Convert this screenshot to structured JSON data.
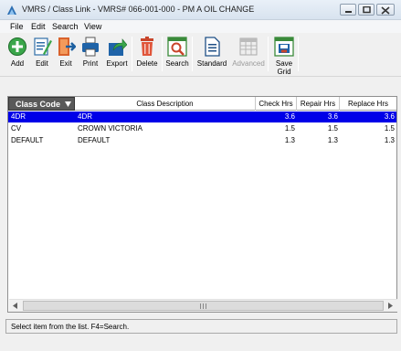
{
  "window": {
    "title": "VMRS / Class Link - VMRS# 066-001-000 - PM A OIL CHANGE"
  },
  "menu": [
    "File",
    "Edit",
    "Search",
    "View"
  ],
  "toolbar": {
    "add": "Add",
    "edit": "Edit",
    "exit": "Exit",
    "print": "Print",
    "export": "Export",
    "delete": "Delete",
    "search": "Search",
    "standard": "Standard",
    "advanced": "Advanced",
    "save_grid_1": "Save",
    "save_grid_2": "Grid"
  },
  "grid": {
    "columns": {
      "class_code": "Class Code",
      "class_description": "Class Description",
      "check_hrs": "Check Hrs",
      "repair_hrs": "Repair Hrs",
      "replace_hrs": "Replace Hrs"
    },
    "rows": [
      {
        "code": "4DR",
        "desc": "4DR",
        "check": "3.6",
        "repair": "3.6",
        "replace": "3.6",
        "selected": true
      },
      {
        "code": "CV",
        "desc": "CROWN VICTORIA",
        "check": "1.5",
        "repair": "1.5",
        "replace": "1.5",
        "selected": false
      },
      {
        "code": "DEFAULT",
        "desc": "DEFAULT",
        "check": "1.3",
        "repair": "1.3",
        "replace": "1.3",
        "selected": false
      }
    ]
  },
  "status": {
    "text": "Select item from the list. F4=Search."
  },
  "colors": {
    "selection": "#0000e8",
    "header_first": "#595959"
  },
  "icons": [
    "app-icon",
    "add-icon",
    "edit-icon",
    "exit-icon",
    "print-icon",
    "export-icon",
    "delete-icon",
    "search-icon",
    "standard-icon",
    "advanced-icon",
    "save-grid-icon"
  ]
}
